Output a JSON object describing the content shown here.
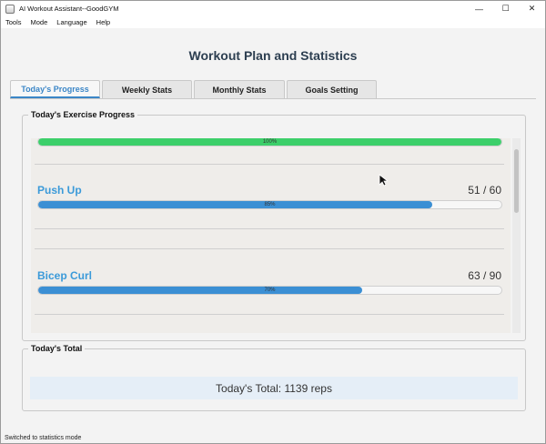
{
  "window": {
    "title": "AI Workout Assistant--GoodGYM",
    "controls": {
      "minimize": "—",
      "maximize": "☐",
      "close": "✕"
    }
  },
  "menu": [
    "Tools",
    "Mode",
    "Language",
    "Help"
  ],
  "page_title": "Workout Plan and Statistics",
  "tabs": [
    {
      "label": "Today's Progress",
      "active": true
    },
    {
      "label": "Weekly Stats",
      "active": false
    },
    {
      "label": "Monthly Stats",
      "active": false
    },
    {
      "label": "Goals Setting",
      "active": false
    }
  ],
  "progress_group": {
    "title": "Today's Exercise Progress",
    "exercises": [
      {
        "name": "",
        "count": "",
        "percent": 100,
        "label": "100%",
        "color": "#3ccf6a"
      },
      {
        "name": "Push Up",
        "count": "51 / 60",
        "percent": 85,
        "label": "85%",
        "color": "#3b8fd4"
      },
      {
        "name": "Bicep Curl",
        "count": "63 / 90",
        "percent": 70,
        "label": "70%",
        "color": "#3b8fd4"
      }
    ]
  },
  "total_group": {
    "title": "Today's Total",
    "text": "Today's Total: 1139 reps"
  },
  "status": "Switched to statistics mode",
  "colors": {
    "accent": "#3b86c7",
    "exercise_name": "#3b9ad9",
    "complete": "#3ccf6a",
    "title": "#2c3e50"
  }
}
